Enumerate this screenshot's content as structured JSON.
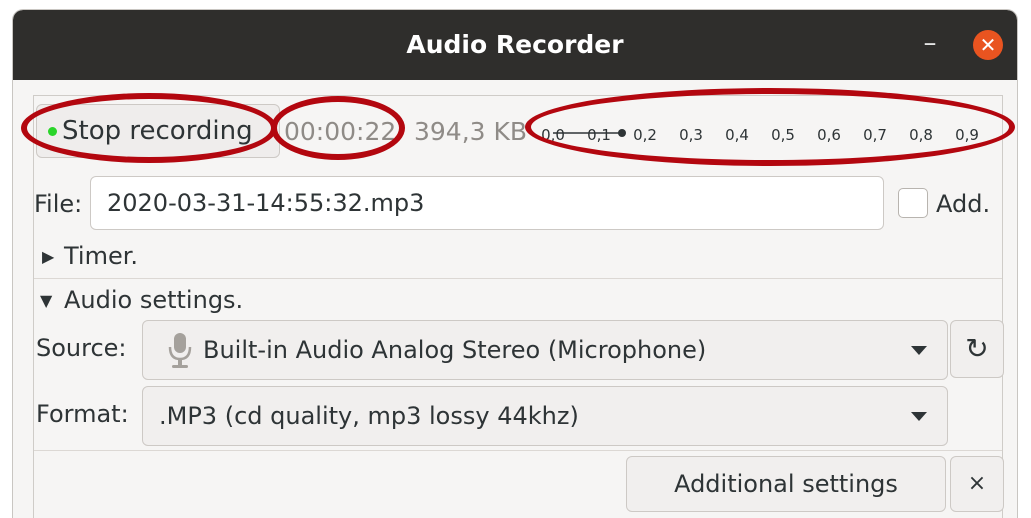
{
  "window": {
    "title": "Audio Recorder",
    "minimize_glyph": "–",
    "close_glyph": "✕"
  },
  "recorder": {
    "stop_label": "Stop recording",
    "elapsed": "00:00:22",
    "size": "394,3 KB",
    "level_ticks": [
      "0,0",
      "0,1",
      "0,2",
      "0,3",
      "0,4",
      "0,5",
      "0,6",
      "0,7",
      "0,8",
      "0,9"
    ],
    "level_value": 0.15,
    "status_color": "#2ad52a"
  },
  "file": {
    "label": "File:",
    "value": "2020-03-31-14:55:32.mp3",
    "add_label": "Add.",
    "add_checked": false
  },
  "timer": {
    "label": "Timer.",
    "expanded": false
  },
  "audio_settings": {
    "label": "Audio settings.",
    "expanded": true,
    "source_label": "Source:",
    "source_value": "Built-in Audio Analog Stereo (Microphone)",
    "source_icon": "microphone-icon",
    "refresh_glyph": "↻",
    "format_label": "Format:",
    "format_value": ".MP3  (cd quality, mp3 lossy 44khz)"
  },
  "footer": {
    "additional_settings_label": "Additional settings",
    "close_glyph": "×"
  },
  "annotation_color": "#b3070f"
}
